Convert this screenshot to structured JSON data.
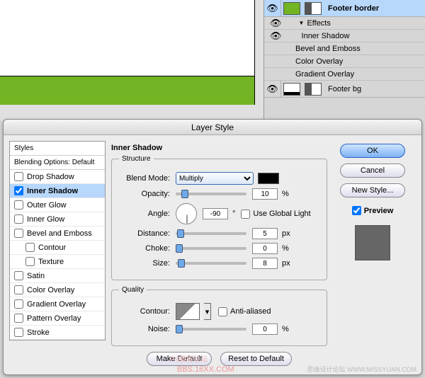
{
  "layers": {
    "row1": {
      "name": "Footer border",
      "thumb_color": "#72b423"
    },
    "effects_label": "Effects",
    "effect_items": [
      "Inner Shadow",
      "Bevel and Emboss",
      "Color Overlay",
      "Gradient Overlay"
    ],
    "row2": {
      "name": "Footer bg"
    }
  },
  "dialog": {
    "title": "Layer Style",
    "styles_header": "Styles",
    "blending_header": "Blending Options: Default",
    "style_list": [
      {
        "key": "drop_shadow",
        "label": "Drop Shadow",
        "checked": false
      },
      {
        "key": "inner_shadow",
        "label": "Inner Shadow",
        "checked": true,
        "selected": true
      },
      {
        "key": "outer_glow",
        "label": "Outer Glow",
        "checked": false
      },
      {
        "key": "inner_glow",
        "label": "Inner Glow",
        "checked": false
      },
      {
        "key": "bevel_emboss",
        "label": "Bevel and Emboss",
        "checked": false
      },
      {
        "key": "contour",
        "label": "Contour",
        "checked": false,
        "sub": true
      },
      {
        "key": "texture",
        "label": "Texture",
        "checked": false,
        "sub": true
      },
      {
        "key": "satin",
        "label": "Satin",
        "checked": false
      },
      {
        "key": "color_overlay",
        "label": "Color Overlay",
        "checked": false
      },
      {
        "key": "gradient_overlay",
        "label": "Gradient Overlay",
        "checked": false
      },
      {
        "key": "pattern_overlay",
        "label": "Pattern Overlay",
        "checked": false
      },
      {
        "key": "stroke",
        "label": "Stroke",
        "checked": false
      }
    ],
    "section_title": "Inner Shadow",
    "structure_legend": "Structure",
    "quality_legend": "Quality",
    "labels": {
      "blend_mode": "Blend Mode:",
      "opacity": "Opacity:",
      "angle": "Angle:",
      "use_global": "Use Global Light",
      "distance": "Distance:",
      "choke": "Choke:",
      "size": "Size:",
      "contour": "Contour:",
      "anti_aliased": "Anti-aliased",
      "noise": "Noise:"
    },
    "values": {
      "blend_mode": "Multiply",
      "opacity": "10",
      "opacity_unit": "%",
      "angle": "-90",
      "angle_deg": "°",
      "use_global": false,
      "distance": "5",
      "distance_unit": "px",
      "choke": "0",
      "choke_unit": "%",
      "size": "8",
      "size_unit": "px",
      "anti_aliased": false,
      "noise": "0",
      "noise_unit": "%",
      "color": "#000000"
    },
    "buttons": {
      "make_default": "Make Default",
      "reset_default": "Reset to Default",
      "ok": "OK",
      "cancel": "Cancel",
      "new_style": "New Style...",
      "preview": "Preview"
    }
  },
  "watermarks": {
    "w1": "思缘设计论坛  WWW.MISSYUAN.COM",
    "w2": "PS教程论坛",
    "w3": "BBS.16XX.COM"
  }
}
